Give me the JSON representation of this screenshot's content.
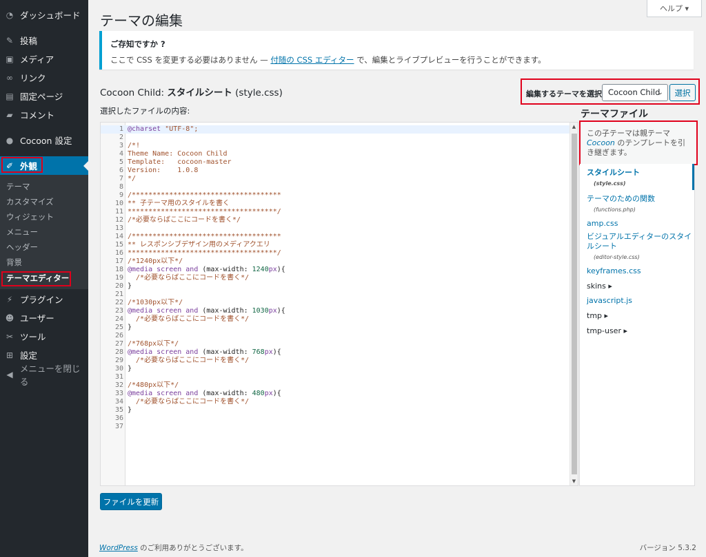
{
  "sidebar": {
    "items": [
      {
        "label": "ダッシュボード",
        "icon": "dashboard-icon"
      },
      {
        "label": "投稿",
        "icon": "pin-icon"
      },
      {
        "label": "メディア",
        "icon": "media-icon"
      },
      {
        "label": "リンク",
        "icon": "link-icon"
      },
      {
        "label": "固定ページ",
        "icon": "page-icon"
      },
      {
        "label": "コメント",
        "icon": "comment-icon"
      },
      {
        "label": "Cocoon 設定",
        "icon": "circle-icon"
      },
      {
        "label": "外観",
        "icon": "brush-icon"
      },
      {
        "label": "プラグイン",
        "icon": "plugin-icon"
      },
      {
        "label": "ユーザー",
        "icon": "user-icon"
      },
      {
        "label": "ツール",
        "icon": "wrench-icon"
      },
      {
        "label": "設定",
        "icon": "settings-icon"
      },
      {
        "label": "メニューを閉じる",
        "icon": "collapse-icon"
      }
    ],
    "submenu": [
      "テーマ",
      "カスタマイズ",
      "ウィジェット",
      "メニュー",
      "ヘッダー",
      "背景",
      "テーマエディター"
    ]
  },
  "header": {
    "help_label": "ヘルプ ▾",
    "title": "テーマの編集"
  },
  "notice": {
    "title": "ご存知ですか ?",
    "text_before": "ここで CSS を変更する必要はありません — ",
    "link": "付随の CSS エディター",
    "text_after": " で、編集とライブプレビューを行うことができます。"
  },
  "editor_header": {
    "theme_name": "Cocoon Child: ",
    "file_title": "スタイルシート",
    "file_name": " (style.css)",
    "content_label": "選択したファイルの内容:"
  },
  "theme_select": {
    "label": "編集するテーマを選択:",
    "value": "Cocoon Child",
    "button": "選択"
  },
  "code_lines": [
    "@charset \"UTF-8\";",
    "",
    "/*!",
    "Theme Name: Cocoon Child",
    "Template:   cocoon-master",
    "Version:    1.0.8",
    "*/",
    "",
    "/************************************",
    "** 子テーマ用のスタイルを書く",
    "************************************/",
    "/*必要ならばここにコードを書く*/",
    "",
    "/************************************",
    "** レスポンシブデザイン用のメディアクエリ",
    "************************************/",
    "/*1240px以下*/",
    "@media screen and (max-width: 1240px){",
    "  /*必要ならばここにコードを書く*/",
    "}",
    "",
    "/*1030px以下*/",
    "@media screen and (max-width: 1030px){",
    "  /*必要ならばここにコードを書く*/",
    "}",
    "",
    "/*768px以下*/",
    "@media screen and (max-width: 768px){",
    "  /*必要ならばここにコードを書く*/",
    "}",
    "",
    "/*480px以下*/",
    "@media screen and (max-width: 480px){",
    "  /*必要ならばここにコードを書く*/",
    "}",
    "",
    ""
  ],
  "files": {
    "title": "テーマファイル",
    "child_notice_before": "この子テーマは親テーマ ",
    "child_notice_parent": "Cocoon",
    "child_notice_after": " のテンプレートを引き継ぎます。",
    "list": [
      {
        "label": "スタイルシート",
        "sub": "(style.css)"
      },
      {
        "label": "テーマのための関数",
        "sub": "(functions.php)"
      },
      {
        "label": "amp.css",
        "sub": ""
      },
      {
        "label": "ビジュアルエディターのスタイルシート",
        "sub": "(editor-style.css)"
      },
      {
        "label": "keyframes.css",
        "sub": ""
      },
      {
        "label": "skins ▸",
        "sub": ""
      },
      {
        "label": "javascript.js",
        "sub": ""
      },
      {
        "label": "tmp ▸",
        "sub": ""
      },
      {
        "label": "tmp-user ▸",
        "sub": ""
      }
    ]
  },
  "actions": {
    "update_button": "ファイルを更新"
  },
  "footer": {
    "link": "WordPress",
    "text": " のご利用ありがとうございます。",
    "version": "バージョン 5.3.2"
  },
  "colors": {
    "accent": "#0073aa",
    "sidebar_bg": "#23282d",
    "highlight_box": "#e0001b"
  }
}
